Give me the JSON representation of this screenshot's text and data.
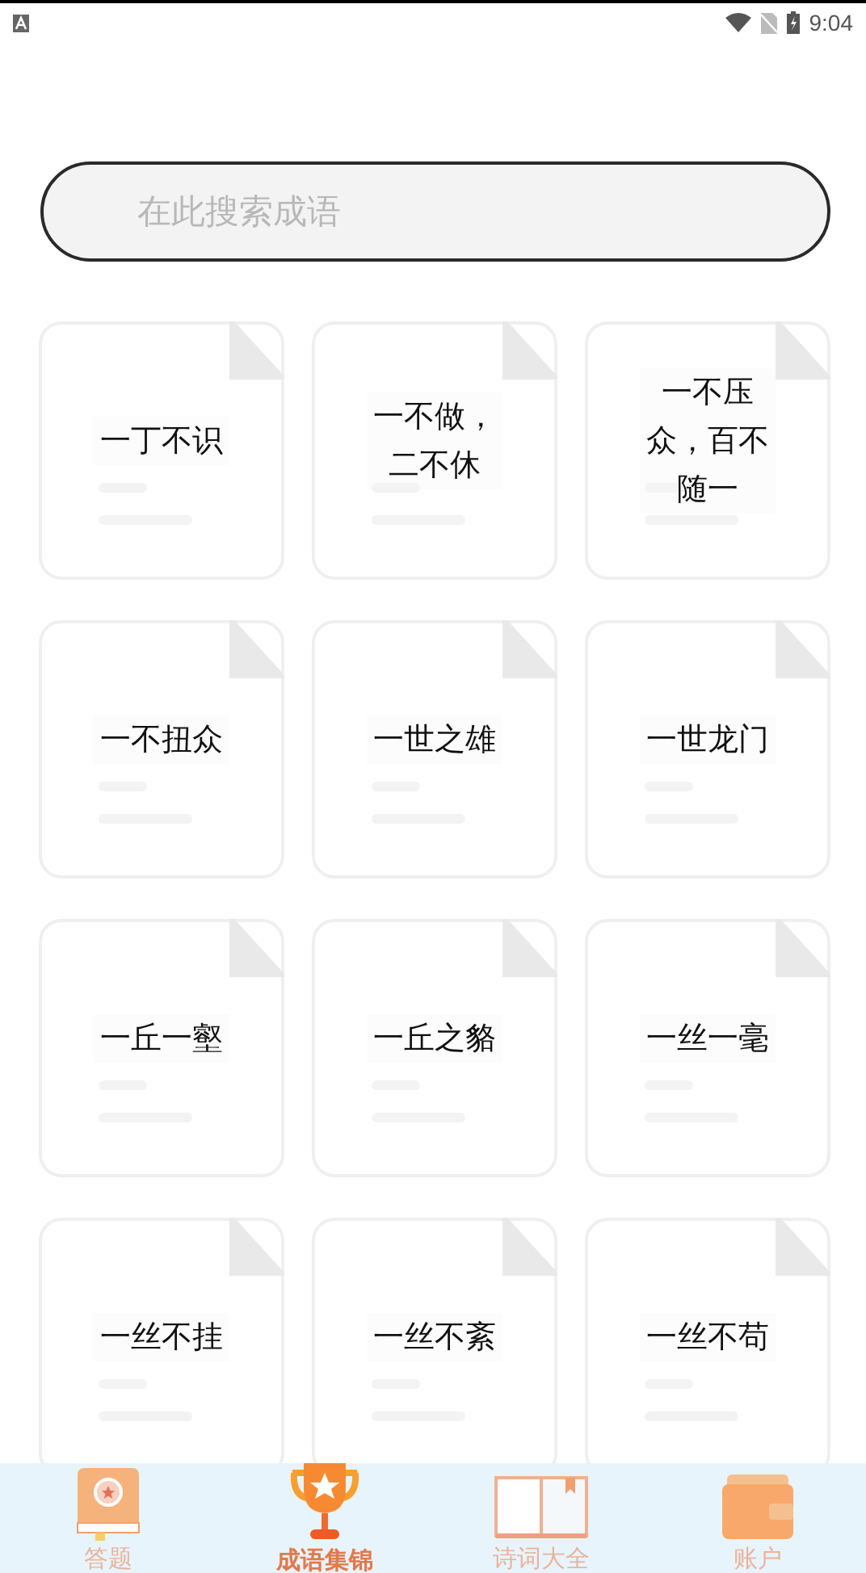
{
  "status_bar": {
    "time": "9:04"
  },
  "search": {
    "placeholder": "在此搜索成语"
  },
  "idioms": [
    {
      "text": "一丁不识"
    },
    {
      "text": "一不做，二不休"
    },
    {
      "text": "一不压众，百不随一"
    },
    {
      "text": "一不扭众"
    },
    {
      "text": "一世之雄"
    },
    {
      "text": "一世龙门"
    },
    {
      "text": "一丘一壑"
    },
    {
      "text": "一丘之貉"
    },
    {
      "text": "一丝一毫"
    },
    {
      "text": "一丝不挂"
    },
    {
      "text": "一丝不紊"
    },
    {
      "text": "一丝不苟"
    }
  ],
  "tabs": [
    {
      "label": "答题",
      "kind": "quiz",
      "selected": false
    },
    {
      "label": "成语集锦",
      "kind": "collection",
      "selected": true
    },
    {
      "label": "诗词大全",
      "kind": "poetry",
      "selected": false
    },
    {
      "label": "账户",
      "kind": "account",
      "selected": false
    }
  ]
}
